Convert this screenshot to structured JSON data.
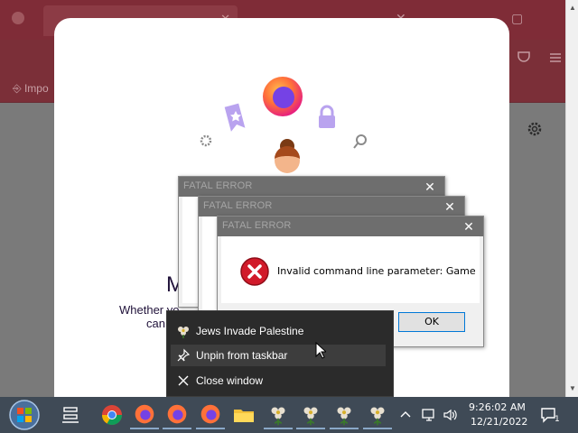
{
  "browser": {
    "tab_close_glyph": "✕",
    "bookmark_text": "Impo",
    "window_controls": [
      "✕",
      "▢"
    ],
    "settings_icon": "gear-icon"
  },
  "welcome": {
    "title_partial": "M",
    "subtitle_lines": [
      "Whether yo",
      "can"
    ]
  },
  "error_dialogs": [
    {
      "title": "FATAL ERROR",
      "close_glyph": "✕"
    },
    {
      "title": "FATAL ERROR",
      "close_glyph": "✕"
    },
    {
      "title": "FATAL ERROR",
      "close_glyph": "✕",
      "message": "Invalid command line parameter: Game",
      "ok_label": "OK"
    }
  ],
  "jumplist": {
    "items": [
      {
        "label": "Jews Invade Palestine",
        "icon": "flower-icon"
      },
      {
        "label": "Unpin from taskbar",
        "icon": "unpin-icon"
      },
      {
        "label": "Close window",
        "icon": "close-icon"
      }
    ]
  },
  "taskbar": {
    "time": "9:26:02 AM",
    "date": "12/21/2022",
    "notification_badge": "1",
    "accent": "#3f4a56"
  }
}
